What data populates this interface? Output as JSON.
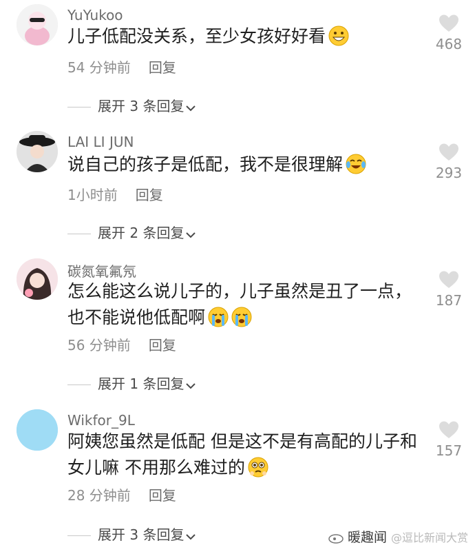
{
  "comments": [
    {
      "username": "YuYukoo",
      "text": "儿子低配没关系，至少女孩好好看",
      "time": "54 分钟前",
      "reply_label": "回复",
      "likes": "468",
      "expand_label": "展开 3 条回复",
      "avatar_color": "#f0c8d6",
      "emoji": [
        "grinning-face"
      ]
    },
    {
      "username": "LAI LI JUN",
      "text": "说自己的孩子是低配，我不是很理解",
      "time": "1小时前",
      "reply_label": "回复",
      "likes": "293",
      "expand_label": "展开 2 条回复",
      "avatar_color": "#cfcfcf",
      "emoji": [
        "tears-of-joy-face"
      ]
    },
    {
      "username": "碳氮氧氟氖",
      "text_line1": "怎么能这么说儿子的，儿子虽然是丑了一点，",
      "text_line2": "也不能说他低配啊",
      "time": "56 分钟前",
      "reply_label": "回复",
      "likes": "187",
      "expand_label": "展开 1 条回复",
      "avatar_color": "#f3d7dd",
      "emoji": [
        "loudly-crying-face",
        "loudly-crying-face"
      ]
    },
    {
      "username": "Wikfor_9L",
      "text_line1": "阿姨您虽然是低配 但是这不是有高配的儿子和",
      "text_line2": "女儿嘛 不用那么难过的",
      "time": "28 分钟前",
      "reply_label": "回复",
      "likes": "157",
      "expand_label": "展开 3 条回复",
      "avatar_color": "#9fdcf5",
      "emoji": [
        "pleading-face"
      ]
    }
  ],
  "watermark": {
    "main": "暖趣闻",
    "secondary": "@逗比新闻大赏"
  }
}
